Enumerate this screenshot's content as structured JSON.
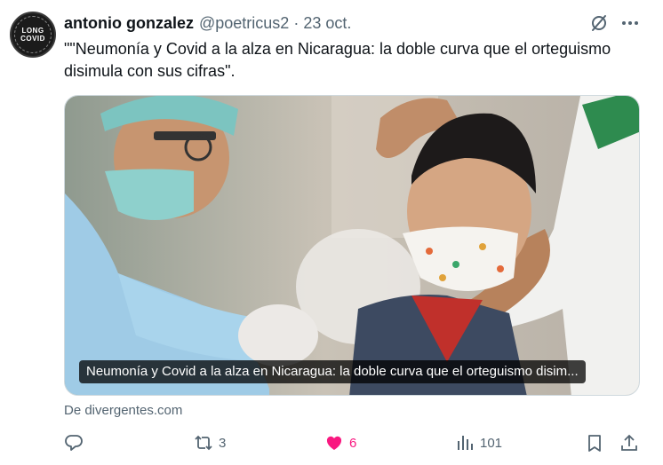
{
  "tweet": {
    "author_name": "antonio gonzalez",
    "handle": "@poetricus2",
    "separator": "·",
    "date": "23 oct.",
    "text": "\"\"Neumonía y Covid a la alza en Nicaragua: la doble curva que el orteguismo disimula con sus cifras\".",
    "avatar": {
      "line1": "LONG",
      "line2": "COVID"
    }
  },
  "card": {
    "caption": "Neumonía y Covid a la alza en Nicaragua: la doble curva que el orteguismo disim...",
    "source": "De divergentes.com"
  },
  "actions": {
    "reply_count": "",
    "retweet_count": "3",
    "like_count": "6",
    "views_count": "101"
  },
  "colors": {
    "like": "#f91880",
    "muted": "#536471",
    "text": "#0f1419"
  },
  "icons": [
    "grok-icon",
    "more-icon",
    "reply-icon",
    "retweet-icon",
    "heart-icon",
    "views-icon",
    "bookmark-icon",
    "share-icon"
  ]
}
